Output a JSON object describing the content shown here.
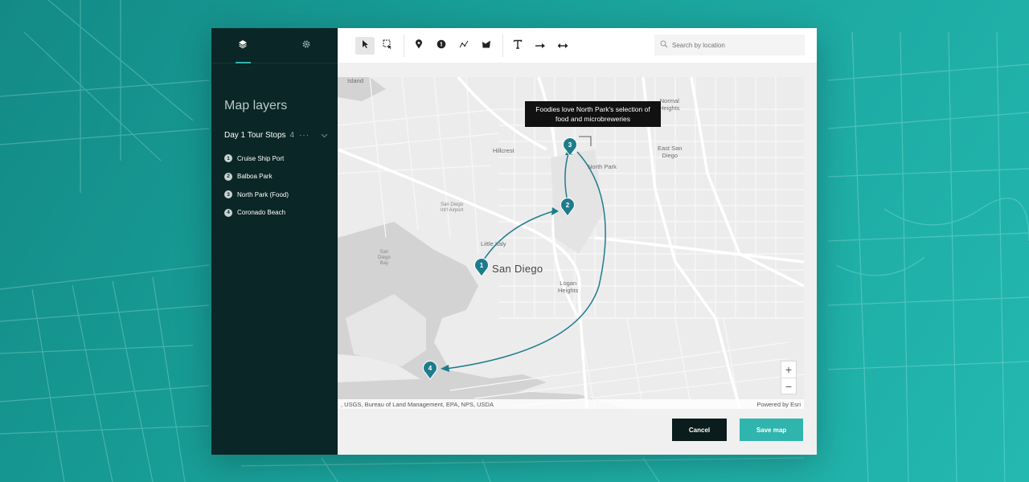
{
  "sidebar": {
    "tabs": [
      {
        "icon": "layers-icon",
        "active": true
      },
      {
        "icon": "gear-icon",
        "active": false
      }
    ],
    "title": "Map layers",
    "group": {
      "name": "Day 1 Tour Stops",
      "count": "4",
      "more": "···"
    },
    "items": [
      {
        "num": "1",
        "label": "Cruise Ship Port"
      },
      {
        "num": "2",
        "label": "Balboa Park"
      },
      {
        "num": "3",
        "label": "North Park (Food)"
      },
      {
        "num": "4",
        "label": "Coronado Beach"
      }
    ]
  },
  "toolbar": {
    "tools": [
      "select-icon",
      "box-select-icon",
      "pin-icon",
      "numbered-marker-icon",
      "line-icon",
      "area-icon",
      "text-icon",
      "arrow-icon",
      "double-arrow-icon"
    ],
    "search_placeholder": "Search by location"
  },
  "map": {
    "callout": "Foodies love North Park's selection of food and microbreweries",
    "labels": {
      "island": "Island",
      "normal_heights": "Normal\nHeights",
      "hillcrest": "Hillcrest",
      "east_san_diego": "East San\nDiego",
      "north_park": "North Park",
      "airport": "San Diego\nInt'l Airport",
      "little_italy": "Little Italy",
      "bay": "San\nDiego\nBay",
      "san_diego": "San Diego",
      "logan_heights": "Logan\nHeights"
    },
    "markers": [
      "1",
      "2",
      "3",
      "4"
    ],
    "attribution": ", USGS, Bureau of Land Management, EPA, NPS, USDA",
    "powered_by": "Powered by Esri",
    "zoom_in": "+",
    "zoom_out": "−"
  },
  "actions": {
    "cancel": "Cancel",
    "save": "Save map"
  },
  "colors": {
    "accent": "#2fb5ad",
    "sidebar": "#0a2626",
    "marker": "#1e7c8c"
  }
}
